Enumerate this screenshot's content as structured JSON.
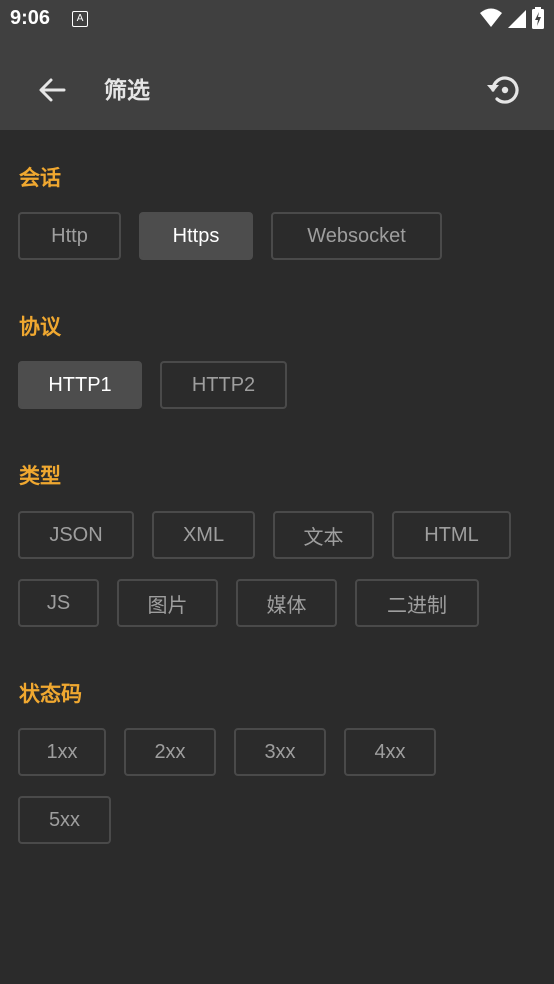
{
  "status_bar": {
    "time": "9:06",
    "notif_icon_letter": "A"
  },
  "toolbar": {
    "title": "筛选"
  },
  "sections": [
    {
      "title": "会话",
      "chips": [
        {
          "label": "Http",
          "selected": false
        },
        {
          "label": "Https",
          "selected": true
        },
        {
          "label": "Websocket",
          "selected": false
        }
      ]
    },
    {
      "title": "协议",
      "chips": [
        {
          "label": "HTTP1",
          "selected": true
        },
        {
          "label": "HTTP2",
          "selected": false
        }
      ]
    },
    {
      "title": "类型",
      "chips": [
        {
          "label": "JSON",
          "selected": false
        },
        {
          "label": "XML",
          "selected": false
        },
        {
          "label": "文本",
          "selected": false
        },
        {
          "label": "HTML",
          "selected": false
        },
        {
          "label": "JS",
          "selected": false
        },
        {
          "label": "图片",
          "selected": false
        },
        {
          "label": "媒体",
          "selected": false
        },
        {
          "label": "二进制",
          "selected": false
        }
      ]
    },
    {
      "title": "状态码",
      "chips": [
        {
          "label": "1xx",
          "selected": false
        },
        {
          "label": "2xx",
          "selected": false
        },
        {
          "label": "3xx",
          "selected": false
        },
        {
          "label": "4xx",
          "selected": false
        },
        {
          "label": "5xx",
          "selected": false
        }
      ]
    }
  ],
  "colors": {
    "accent": "#f0a830",
    "background": "#2b2b2b",
    "toolbar": "#404040"
  }
}
